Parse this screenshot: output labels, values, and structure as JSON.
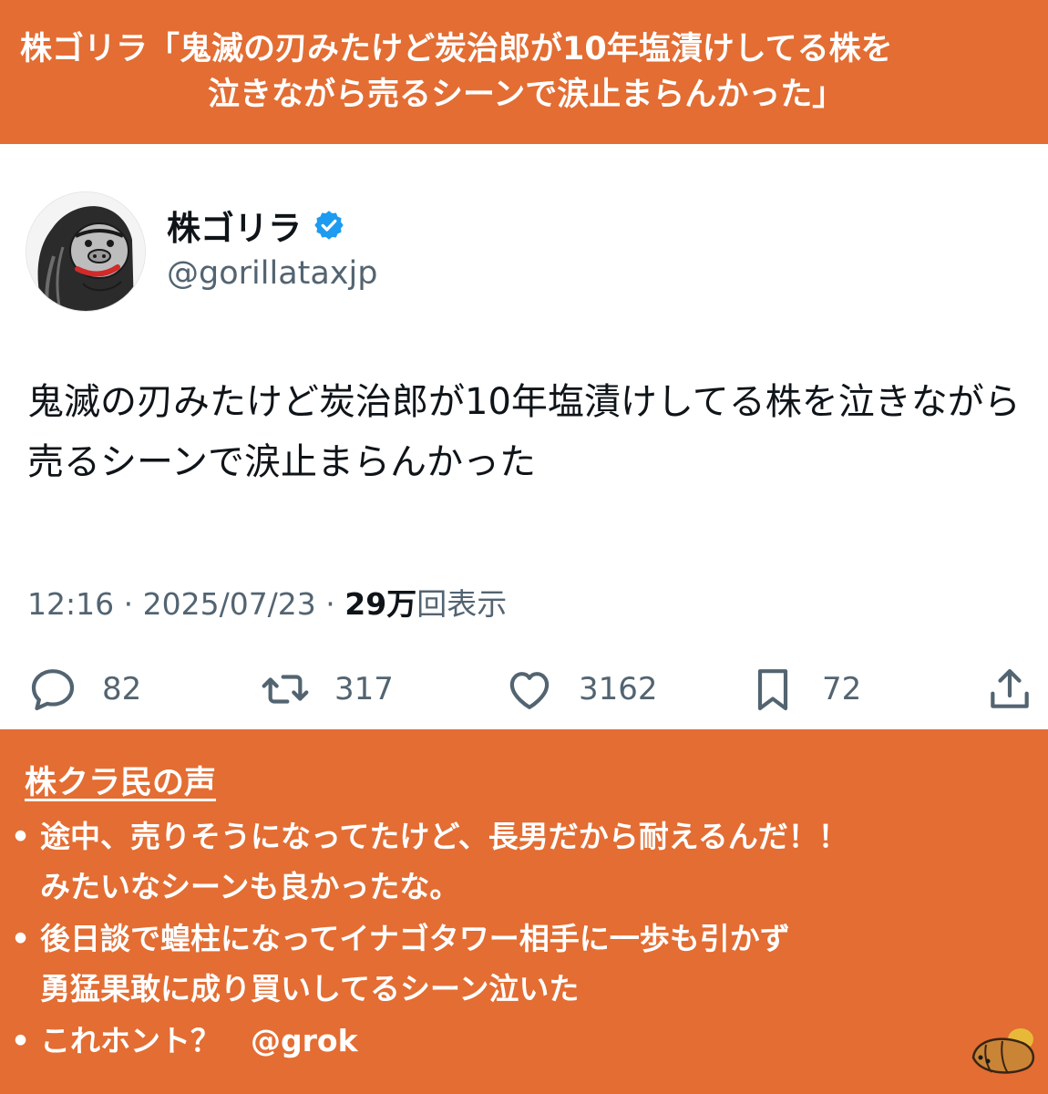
{
  "header": {
    "line1": "株ゴリラ「鬼滅の刃みたけど炭治郎が10年塩漬けしてる株を",
    "line2": "泣きながら売るシーンで涙止まらんかった」"
  },
  "tweet": {
    "display_name": "株ゴリラ",
    "handle": "@gorillataxjp",
    "text": "鬼滅の刃みたけど炭治郎が10年塩漬けしてる株を泣きながら売るシーンで涙止まらんかった",
    "time": "12:16",
    "separator": " · ",
    "date": "2025/07/23",
    "views_count": "29万",
    "views_label": "回表示",
    "actions": {
      "replies": "82",
      "retweets": "317",
      "likes": "3162",
      "bookmarks": "72"
    },
    "icons": [
      "verified-badge-icon",
      "reply-icon",
      "retweet-icon",
      "like-icon",
      "bookmark-icon",
      "share-icon"
    ],
    "colors": {
      "verified": "#1d9bf0",
      "secondary_text": "#536471"
    }
  },
  "panel": {
    "heading": "株クラ民の声",
    "bullet": "•",
    "comments": [
      {
        "line1": "途中、売りそうになってたけど、長男だから耐えるんだ！！",
        "line2": "みたいなシーンも良かったな。"
      },
      {
        "line1": "後日談で蝗柱になってイナゴタワー相手に一歩も引かず",
        "line2": "勇猛果敢に成り買いしてるシーン泣いた"
      },
      {
        "line1": "これホント？　@grok",
        "line2": ""
      }
    ],
    "colors": {
      "banner": "#e36d33",
      "text": "#ffffff"
    }
  }
}
